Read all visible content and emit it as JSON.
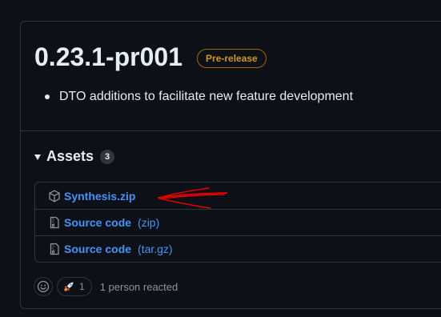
{
  "release": {
    "title": "0.23.1-pr001",
    "badge": "Pre-release",
    "notes": [
      "DTO additions to facilitate new feature development"
    ]
  },
  "assets": {
    "label": "Assets",
    "count": "3",
    "items": [
      {
        "name": "Synthesis.zip",
        "ext": "",
        "icon": "package-icon"
      },
      {
        "name": "Source code",
        "ext": "(zip)",
        "icon": "file-zip-icon"
      },
      {
        "name": "Source code",
        "ext": "(tar.gz)",
        "icon": "file-zip-icon"
      }
    ]
  },
  "reactions": {
    "emoji_picker_icon": "smiley-icon",
    "rocket_count": "1",
    "summary": "1 person reacted"
  },
  "colors": {
    "background": "#0d1117",
    "border": "#30363d",
    "link": "#4493f8",
    "prerelease": "#d29922",
    "annotation": "#e00000"
  }
}
